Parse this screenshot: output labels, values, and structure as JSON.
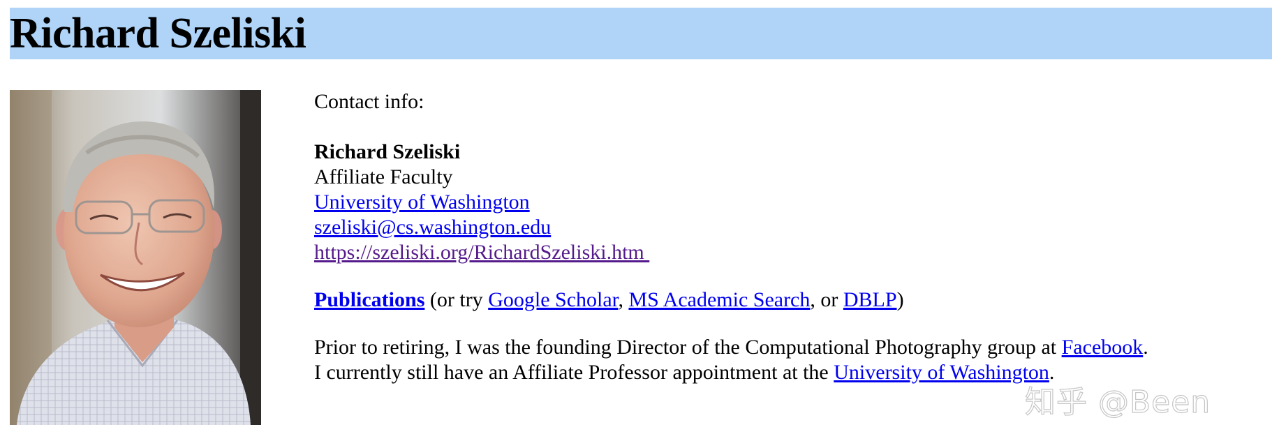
{
  "header": {
    "title": "Richard Szeliski",
    "bg_color": "#afd4f8"
  },
  "contact": {
    "heading": "Contact info:",
    "name": "Richard Szeliski",
    "role": "Affiliate Faculty",
    "university_link": "University of Washington",
    "email_link": "szeliski@cs.washington.edu",
    "homepage_link": "https://szeliski.org/RichardSzeliski.htm "
  },
  "publications": {
    "main_link": "Publications",
    "text_or_try": " (or try ",
    "scholar_link": "Google Scholar",
    "comma1": ", ",
    "ms_link": "MS Academic Search",
    "text_or": ", or ",
    "dblp_link": "DBLP",
    "close_paren": ")"
  },
  "bio": {
    "line1_text": "Prior to retiring, I was the founding Director of the Computational Photography group at ",
    "facebook_link": "Facebook",
    "line1_end": ".",
    "line2_text": "I currently still have an Affiliate Professor appointment at the ",
    "university_link": "University of Washington",
    "line2_end": "."
  },
  "portrait": {
    "icon": "person-photo",
    "background_color": "#cfd3d6"
  },
  "watermark": {
    "text": "知乎 @Been"
  },
  "colors": {
    "link": "#0000ee",
    "visited_link": "#551a8b"
  }
}
